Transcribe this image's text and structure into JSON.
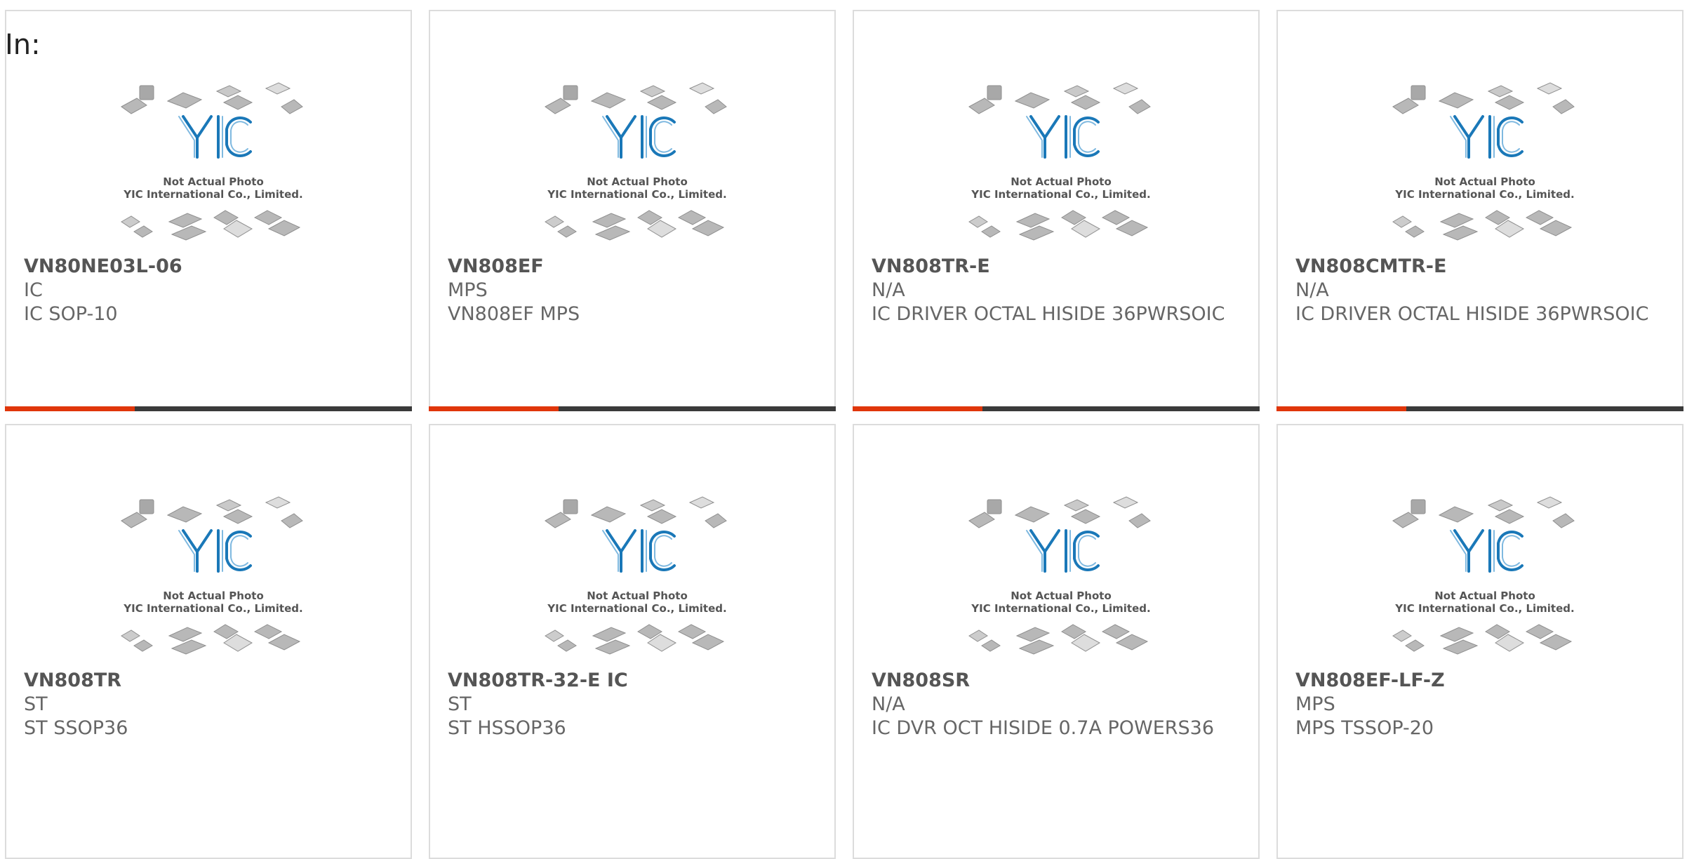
{
  "filter_label": "In:",
  "placeholder": {
    "line1": "Not Actual Photo",
    "line2": "YIC International Co., Limited.",
    "logo_text": "YIC"
  },
  "colors": {
    "accent": "#e0360b",
    "bar": "#3a3a3a",
    "logo": "#1a78b8",
    "chip": "#b8b8b8"
  },
  "products": [
    {
      "part": "VN80NE03L-06",
      "maker": "IC",
      "desc": "IC SOP-10"
    },
    {
      "part": "VN808EF",
      "maker": "MPS",
      "desc": "VN808EF MPS"
    },
    {
      "part": "VN808TR-E",
      "maker": "N/A",
      "desc": "IC DRIVER OCTAL HISIDE 36PWRSOIC"
    },
    {
      "part": "VN808CMTR-E",
      "maker": "N/A",
      "desc": "IC DRIVER OCTAL HISIDE 36PWRSOIC"
    },
    {
      "part": "VN808TR",
      "maker": "ST",
      "desc": "ST SSOP36"
    },
    {
      "part": "VN808TR-32-E IC",
      "maker": "ST",
      "desc": "ST HSSOP36"
    },
    {
      "part": "VN808SR",
      "maker": "N/A",
      "desc": "IC DVR OCT HISIDE 0.7A POWERS36"
    },
    {
      "part": "VN808EF-LF-Z",
      "maker": "MPS",
      "desc": "MPS TSSOP-20"
    }
  ]
}
